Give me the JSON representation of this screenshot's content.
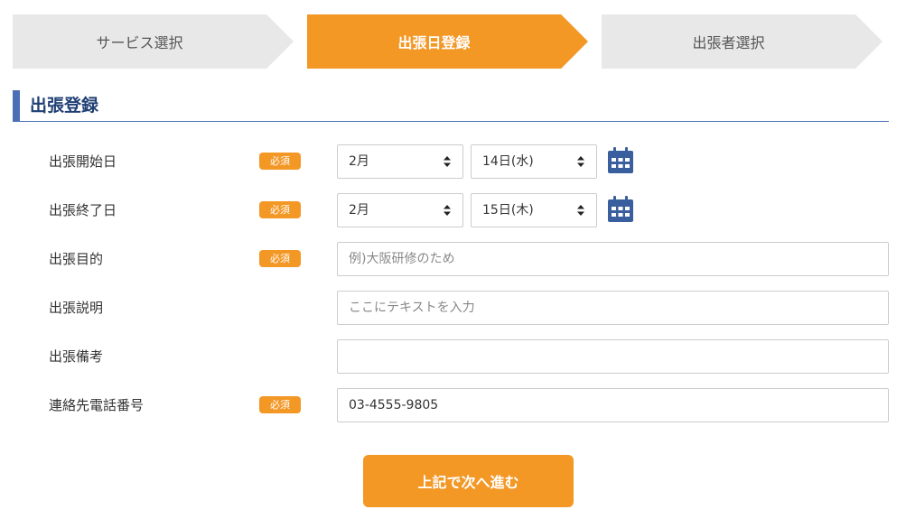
{
  "steps": [
    {
      "label": "サービス選択",
      "state": "inactive"
    },
    {
      "label": "出張日登録",
      "state": "active"
    },
    {
      "label": "出張者選択",
      "state": "inactive"
    }
  ],
  "section": {
    "title": "出張登録"
  },
  "required_badge": "必須",
  "form": {
    "start_date": {
      "label": "出張開始日",
      "month": "2月",
      "day": "14日(水)",
      "icon": "calendar-icon"
    },
    "end_date": {
      "label": "出張終了日",
      "month": "2月",
      "day": "15日(木)",
      "icon": "calendar-icon"
    },
    "purpose": {
      "label": "出張目的",
      "value": "",
      "placeholder": "例)大阪研修のため"
    },
    "description": {
      "label": "出張説明",
      "value": "",
      "placeholder": "ここにテキストを入力"
    },
    "notes": {
      "label": "出張備考",
      "value": "",
      "placeholder": ""
    },
    "phone": {
      "label": "連絡先電話番号",
      "value": "03-4555-9805",
      "placeholder": ""
    }
  },
  "submit": {
    "label": "上記で次へ進む"
  },
  "colors": {
    "accent": "#f39725",
    "heading": "#1f3f73",
    "heading_bar": "#4a6fb5",
    "step_inactive": "#e8e8e8",
    "calendar_icon": "#3a5f9e"
  }
}
